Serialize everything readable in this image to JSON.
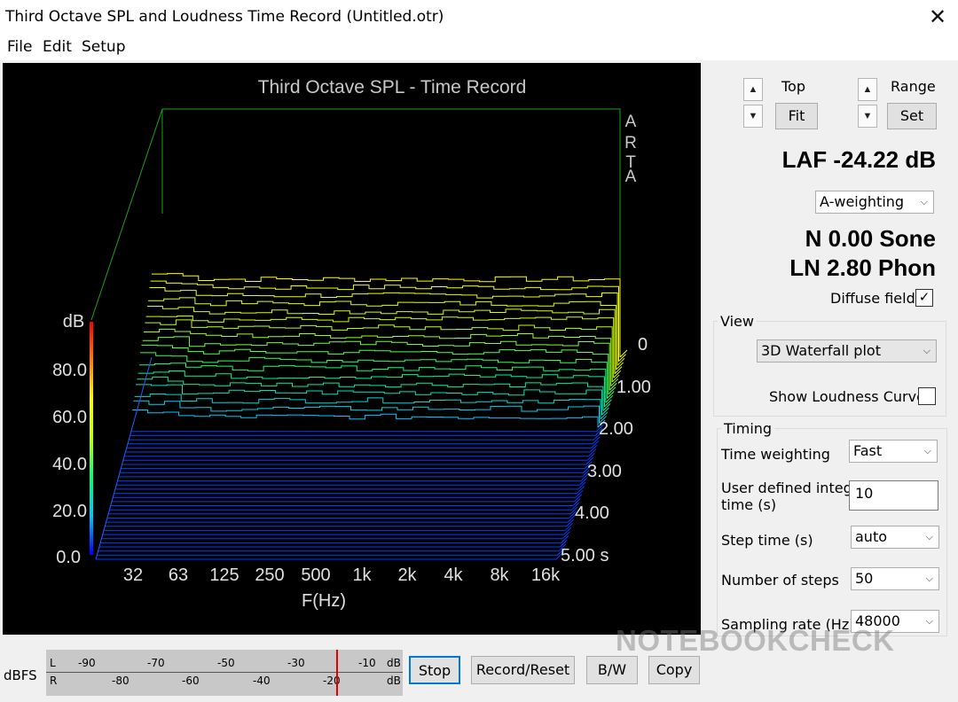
{
  "window": {
    "title": "Third Octave SPL and Loudness Time Record (Untitled.otr)",
    "close_glyph": "✕"
  },
  "menu": {
    "file": "File",
    "edit": "Edit",
    "setup": "Setup"
  },
  "chart_data": {
    "type": "3d-waterfall",
    "title": "Third Octave SPL - Time Record",
    "brand": [
      "A",
      "R",
      "T",
      "A"
    ],
    "ylabel": "dB",
    "xlabel": "F(Hz)",
    "yticks": [
      "0.0",
      "20.0",
      "40.0",
      "60.0",
      "80.0"
    ],
    "xticks": [
      "32",
      "63",
      "125",
      "250",
      "500",
      "1k",
      "2k",
      "4k",
      "8k",
      "16k"
    ],
    "zticks": [
      "0",
      "1.00",
      "2.00",
      "3.00",
      "4.00",
      "5.00 s"
    ],
    "ylim": [
      0,
      100
    ],
    "colorbar": [
      "#0000ff",
      "#00c8ff",
      "#00ff80",
      "#c8ff00",
      "#ffff00",
      "#ff8000",
      "#ff0000"
    ]
  },
  "controls": {
    "top_label": "Top",
    "range_label": "Range",
    "fit_label": "Fit",
    "set_label": "Set",
    "up_glyph": "▲",
    "down_glyph": "▼",
    "laf": "LAF -24.22 dB",
    "weighting": "A-weighting",
    "sone": "N 0.00 Sone",
    "phon": "LN 2.80 Phon",
    "diffuse_label": "Diffuse field",
    "check_glyph": "✓",
    "combo_arrow": "⌵"
  },
  "view": {
    "group_title": "View",
    "plot_type": "3D Waterfall plot",
    "show_loudness_label": "Show Loudness Curves"
  },
  "timing": {
    "group_title": "Timing",
    "time_weighting_label": "Time weighting",
    "time_weighting_value": "Fast",
    "integr_label_1": "User defined integr.",
    "integr_label_2": "time (s)",
    "integr_value": "10",
    "step_label": "Step time (s)",
    "step_value": "auto",
    "steps_label": "Number of steps",
    "steps_value": "50",
    "rate_label": "Sampling rate (Hz)",
    "rate_value": "48000"
  },
  "bottom": {
    "dbfs_label": "dBFS",
    "meter_L": "L",
    "meter_R": "R",
    "meter_unit": "dB",
    "meter_top_ticks": [
      "-90",
      "-70",
      "-50",
      "-30",
      "-10"
    ],
    "meter_bottom_ticks": [
      "-80",
      "-60",
      "-40",
      "-20"
    ],
    "stop_label": "Stop",
    "record_label": "Record/Reset",
    "bw_label": "B/W",
    "copy_label": "Copy"
  },
  "watermark": "NOTEBOOKCHECK"
}
